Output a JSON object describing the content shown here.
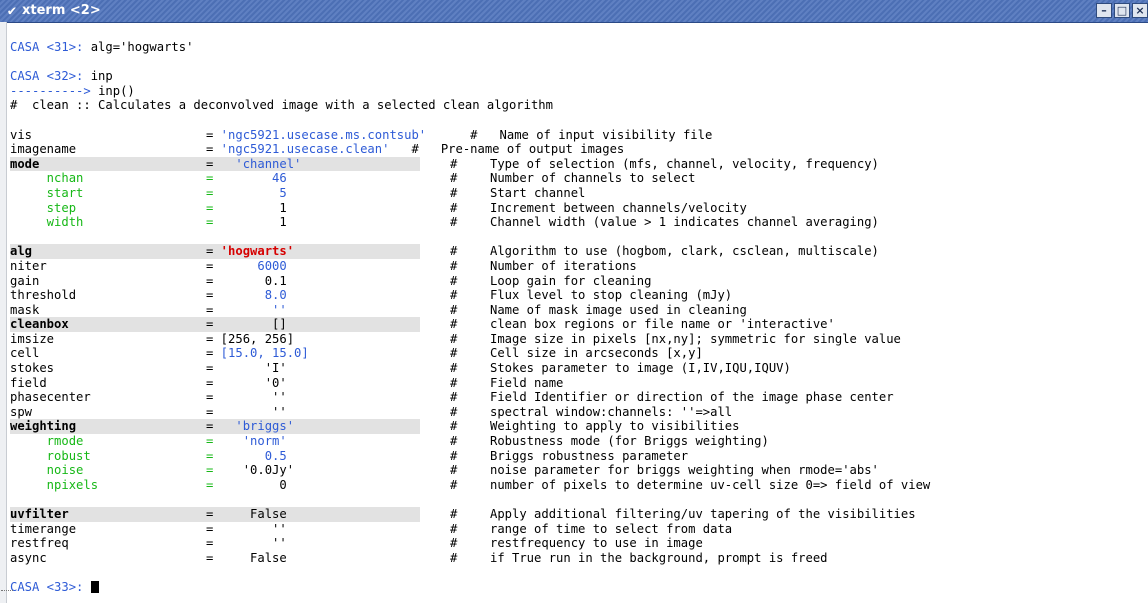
{
  "window": {
    "title": "xterm <2>"
  },
  "prompts": {
    "p31_label": "CASA <31>:",
    "p31_cmd": " alg='hogwarts'",
    "p32_label": "CASA <32>:",
    "p32_cmd": " inp",
    "arrow": "----------> ",
    "arrow_cmd": "inp()",
    "p33_label": "CASA <33>:"
  },
  "header_line": "#  clean :: Calculates a deconvolved image with a selected clean algorithm",
  "params": [
    {
      "name": "vis",
      "eq": "=",
      "value": " 'ngc5921.usecase.ms.contsub'",
      "cmt": "      #   Name of input visibility file",
      "style": "normal",
      "vcolor": "blue",
      "inline": true
    },
    {
      "name": "imagename",
      "eq": "=",
      "value": " 'ngc5921.usecase.clean'",
      "cmt": "   #   Pre-name of output images",
      "style": "normal",
      "vcolor": "blue",
      "inline": true
    },
    {
      "name": "mode",
      "eq": "=",
      "value": "   'channel'",
      "hash": "#",
      "cmt": "Type of selection (mfs, channel, velocity, frequency)",
      "style": "bold",
      "vcolor": "blue"
    },
    {
      "name": "     nchan",
      "eq": "=",
      "value": "        46",
      "hash": "#",
      "cmt": "Number of channels to select",
      "style": "sub",
      "vcolor": "blue"
    },
    {
      "name": "     start",
      "eq": "=",
      "value": "         5",
      "hash": "#",
      "cmt": "Start channel",
      "style": "sub",
      "vcolor": "blue"
    },
    {
      "name": "     step",
      "eq": "=",
      "value": "         1",
      "hash": "#",
      "cmt": "Increment between channels/velocity",
      "style": "sub",
      "vcolor": "black"
    },
    {
      "name": "     width",
      "eq": "=",
      "value": "         1",
      "hash": "#",
      "cmt": "Channel width (value > 1 indicates channel averaging)",
      "style": "sub",
      "vcolor": "black"
    },
    {
      "gap": true
    },
    {
      "name": "alg",
      "eq": "=",
      "value": " 'hogwarts'",
      "hash": "#",
      "cmt": "Algorithm to use (hogbom, clark, csclean, multiscale)",
      "style": "bold",
      "vcolor": "red"
    },
    {
      "name": "niter",
      "eq": "=",
      "value": "      6000",
      "hash": "#",
      "cmt": "Number of iterations",
      "style": "normal",
      "vcolor": "blue"
    },
    {
      "name": "gain",
      "eq": "=",
      "value": "       0.1",
      "hash": "#",
      "cmt": "Loop gain for cleaning",
      "style": "normal",
      "vcolor": "black"
    },
    {
      "name": "threshold",
      "eq": "=",
      "value": "       8.0",
      "hash": "#",
      "cmt": "Flux level to stop cleaning (mJy)",
      "style": "normal",
      "vcolor": "blue"
    },
    {
      "name": "mask",
      "eq": "=",
      "value": "        ''",
      "hash": "#",
      "cmt": "Name of mask image used in cleaning",
      "style": "normal",
      "vcolor": "blue"
    },
    {
      "name": "cleanbox",
      "eq": "=",
      "value": "        []",
      "hash": "#",
      "cmt": "clean box regions or file name or 'interactive'",
      "style": "bold",
      "vcolor": "black"
    },
    {
      "name": "imsize",
      "eq": "=",
      "value": " [256, 256]",
      "hash": "#",
      "cmt": "Image size in pixels [nx,ny]; symmetric for single value",
      "style": "normal",
      "vcolor": "black"
    },
    {
      "name": "cell",
      "eq": "=",
      "value": " [15.0, 15.0]",
      "hash": "#",
      "cmt": "Cell size in arcseconds [x,y]",
      "style": "normal",
      "vcolor": "blue"
    },
    {
      "name": "stokes",
      "eq": "=",
      "value": "       'I'",
      "hash": "#",
      "cmt": "Stokes parameter to image (I,IV,IQU,IQUV)",
      "style": "normal",
      "vcolor": "black"
    },
    {
      "name": "field",
      "eq": "=",
      "value": "       '0'",
      "hash": "#",
      "cmt": "Field name",
      "style": "normal",
      "vcolor": "black"
    },
    {
      "name": "phasecenter",
      "eq": "=",
      "value": "        ''",
      "hash": "#",
      "cmt": "Field Identifier or direction of the image phase center",
      "style": "normal",
      "vcolor": "black"
    },
    {
      "name": "spw",
      "eq": "=",
      "value": "        ''",
      "hash": "#",
      "cmt": "spectral window:channels: ''=>all",
      "style": "normal",
      "vcolor": "black"
    },
    {
      "name": "weighting",
      "eq": "=",
      "value": "   'briggs'",
      "hash": "#",
      "cmt": "Weighting to apply to visibilities",
      "style": "bold",
      "vcolor": "blue"
    },
    {
      "name": "     rmode",
      "eq": "=",
      "value": "    'norm'",
      "hash": "#",
      "cmt": "Robustness mode (for Briggs weighting)",
      "style": "sub",
      "vcolor": "blue"
    },
    {
      "name": "     robust",
      "eq": "=",
      "value": "       0.5",
      "hash": "#",
      "cmt": "Briggs robustness parameter",
      "style": "sub",
      "vcolor": "blue"
    },
    {
      "name": "     noise",
      "eq": "=",
      "value": "    '0.0Jy'",
      "hash": "#",
      "cmt": "noise parameter for briggs weighting when rmode='abs'",
      "style": "sub",
      "vcolor": "black"
    },
    {
      "name": "     npixels",
      "eq": "=",
      "value": "         0",
      "hash": "#",
      "cmt": "number of pixels to determine uv-cell size 0=> field of view",
      "style": "sub",
      "vcolor": "black"
    },
    {
      "gap": true
    },
    {
      "name": "uvfilter",
      "eq": "=",
      "value": "     False",
      "hash": "#",
      "cmt": "Apply additional filtering/uv tapering of the visibilities",
      "style": "bold",
      "vcolor": "black"
    },
    {
      "name": "timerange",
      "eq": "=",
      "value": "        ''",
      "hash": "#",
      "cmt": "range of time to select from data",
      "style": "normal",
      "vcolor": "black"
    },
    {
      "name": "restfreq",
      "eq": "=",
      "value": "        ''",
      "hash": "#",
      "cmt": "restfrequency to use in image",
      "style": "normal",
      "vcolor": "black"
    },
    {
      "name": "async",
      "eq": "=",
      "value": "     False",
      "hash": "#",
      "cmt": "if True run in the background, prompt is freed",
      "style": "normal",
      "vcolor": "black"
    }
  ]
}
